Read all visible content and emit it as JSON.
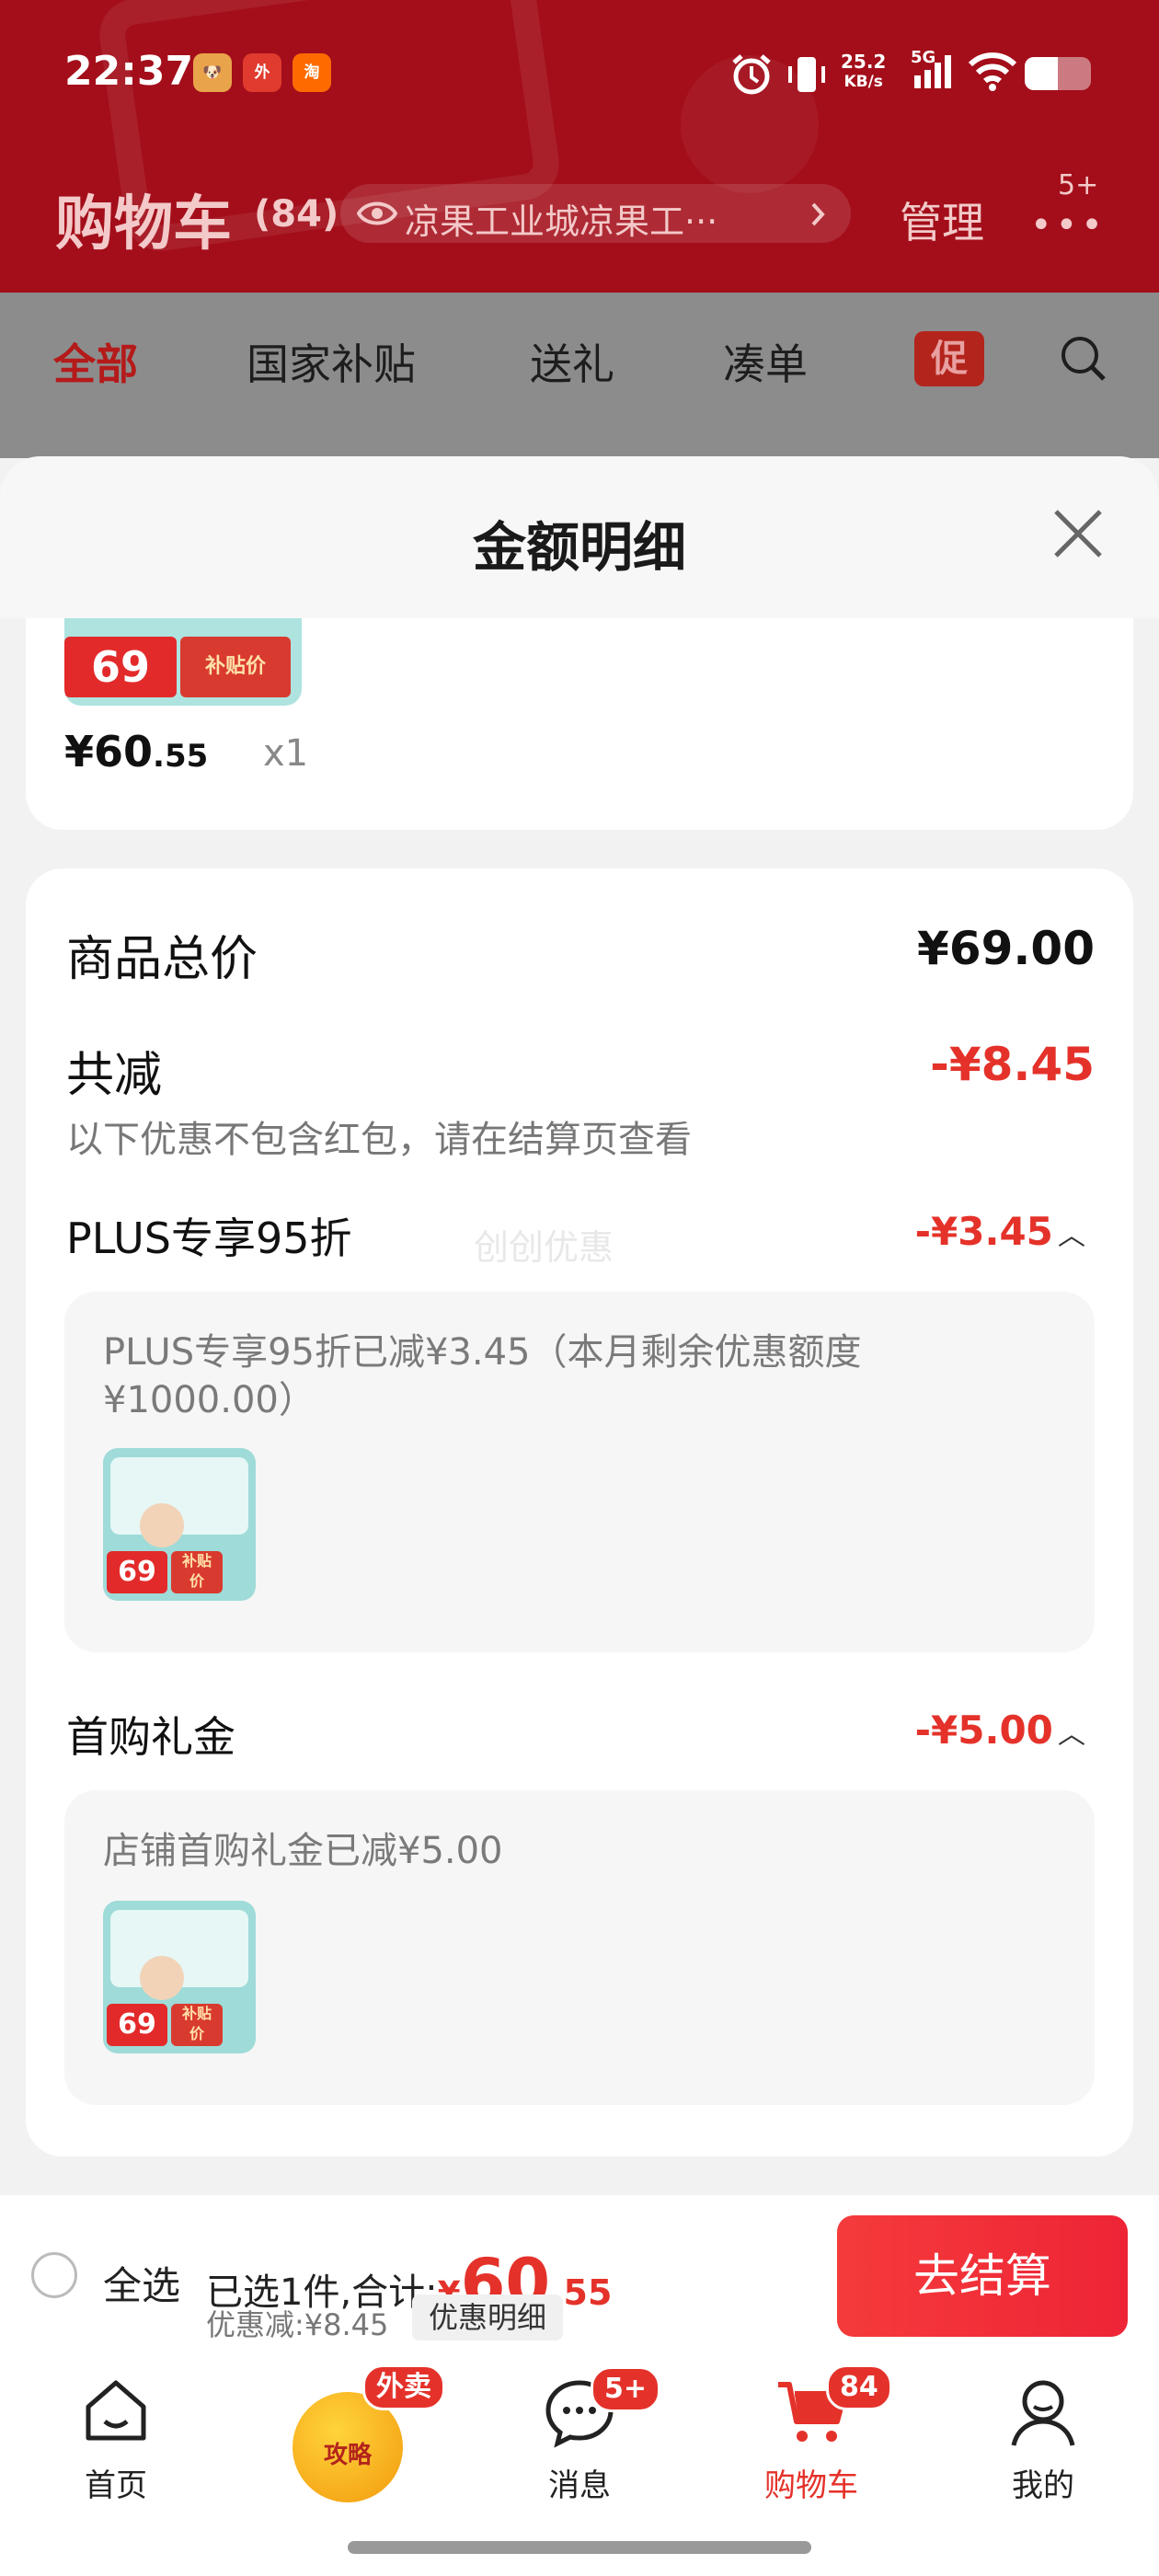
{
  "status_bar": {
    "time": "22:37",
    "apps": [
      {
        "icon": "dog-app-icon",
        "color": "#e9a44b"
      },
      {
        "icon": "waimai-app-icon",
        "color": "#e03b2e"
      },
      {
        "icon": "taobao-app-icon",
        "color": "#ff6a00"
      }
    ],
    "speed_value": "25.2",
    "speed_unit": "KB/s",
    "network": "5G"
  },
  "header": {
    "title": "购物车",
    "count": "(84)",
    "address": "凉果工业城凉果工···",
    "manage": "管理",
    "more_badge": "5+"
  },
  "tabs": [
    {
      "label": "全部",
      "active": true
    },
    {
      "label": "国家补贴",
      "active": false
    },
    {
      "label": "送礼",
      "active": false
    },
    {
      "label": "凑单",
      "active": false
    }
  ],
  "promo_tab": "促",
  "sheet": {
    "title": "金额明细",
    "item": {
      "price_main": "¥60",
      "price_decimal": ".55",
      "qty": "x1",
      "thumb_tag": "69",
      "thumb_tag2": "补贴价"
    },
    "total_label": "商品总价",
    "total_value": "¥69.00",
    "reduce_label": "共减",
    "reduce_value": "-¥8.45",
    "reduce_note": "以下优惠不包含红包，请在结算页查看",
    "watermark": "创创优惠",
    "discounts": [
      {
        "label": "PLUS专享95折",
        "value": "-¥3.45",
        "detail": "PLUS专享95折已减¥3.45（本月剩余优惠额度¥1000.00）"
      },
      {
        "label": "首购礼金",
        "value": "-¥5.00",
        "detail": "店铺首购礼金已减¥5.00"
      }
    ]
  },
  "checkout": {
    "select_all": "全选",
    "selected_prefix": "已选1件,合计:",
    "sum_yen": "¥",
    "sum_int": "60",
    "sum_dec": ".55",
    "discount_text": "优惠减:¥8.45",
    "detail_chip": "优惠明细",
    "button": "去结算"
  },
  "nav": {
    "items": [
      {
        "label": "首页",
        "icon": "home-icon"
      },
      {
        "label": "攻略",
        "icon": "gonglue-icon",
        "badge": "外卖"
      },
      {
        "label": "消息",
        "icon": "message-icon",
        "badge": "5+"
      },
      {
        "label": "购物车",
        "icon": "cart-icon",
        "badge": "84",
        "active": true
      },
      {
        "label": "我的",
        "icon": "profile-icon"
      }
    ]
  },
  "colors": {
    "brand_red": "#e4322a",
    "header_red": "#a30e1a"
  }
}
